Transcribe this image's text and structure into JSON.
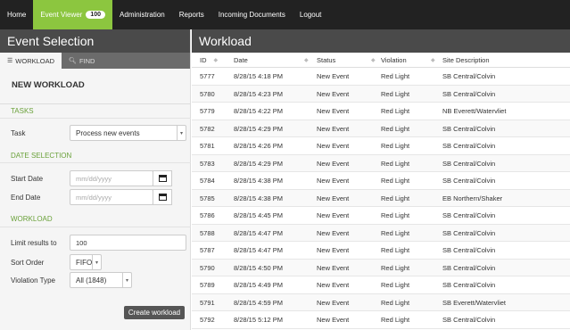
{
  "nav": {
    "home": "Home",
    "event_viewer": "Event Viewer",
    "event_viewer_badge": "100",
    "administration": "Administration",
    "reports": "Reports",
    "incoming_documents": "Incoming Documents",
    "logout": "Logout"
  },
  "left": {
    "title": "Event Selection",
    "tab_workload": "WORKLOAD",
    "tab_find": "FIND",
    "heading": "NEW WORKLOAD",
    "tasks_section": "TASKS",
    "task_label": "Task",
    "task_value": "Process new events",
    "date_section": "DATE SELECTION",
    "start_date_label": "Start Date",
    "start_date_placeholder": "mm/dd/yyyy",
    "end_date_label": "End Date",
    "end_date_placeholder": "mm/dd/yyyy",
    "workload_section": "WORKLOAD",
    "limit_label": "Limit results to",
    "limit_value": "100",
    "sort_label": "Sort Order",
    "sort_value": "FIFO",
    "violation_label": "Violation Type",
    "violation_value": "All (1848)",
    "create_button": "Create workload"
  },
  "right": {
    "title": "Workload",
    "columns": [
      "ID",
      "Date",
      "Status",
      "Violation",
      "Site Description"
    ],
    "rows": [
      [
        "5777",
        "8/28/15 4:18 PM",
        "New Event",
        "Red Light",
        "SB Central/Colvin"
      ],
      [
        "5780",
        "8/28/15 4:23 PM",
        "New Event",
        "Red Light",
        "SB Central/Colvin"
      ],
      [
        "5779",
        "8/28/15 4:22 PM",
        "New Event",
        "Red Light",
        "NB Everett/Watervliet"
      ],
      [
        "5782",
        "8/28/15 4:29 PM",
        "New Event",
        "Red Light",
        "SB Central/Colvin"
      ],
      [
        "5781",
        "8/28/15 4:26 PM",
        "New Event",
        "Red Light",
        "SB Central/Colvin"
      ],
      [
        "5783",
        "8/28/15 4:29 PM",
        "New Event",
        "Red Light",
        "SB Central/Colvin"
      ],
      [
        "5784",
        "8/28/15 4:38 PM",
        "New Event",
        "Red Light",
        "SB Central/Colvin"
      ],
      [
        "5785",
        "8/28/15 4:38 PM",
        "New Event",
        "Red Light",
        "EB Northern/Shaker"
      ],
      [
        "5786",
        "8/28/15 4:45 PM",
        "New Event",
        "Red Light",
        "SB Central/Colvin"
      ],
      [
        "5788",
        "8/28/15 4:47 PM",
        "New Event",
        "Red Light",
        "SB Central/Colvin"
      ],
      [
        "5787",
        "8/28/15 4:47 PM",
        "New Event",
        "Red Light",
        "SB Central/Colvin"
      ],
      [
        "5790",
        "8/28/15 4:50 PM",
        "New Event",
        "Red Light",
        "SB Central/Colvin"
      ],
      [
        "5789",
        "8/28/15 4:49 PM",
        "New Event",
        "Red Light",
        "SB Central/Colvin"
      ],
      [
        "5791",
        "8/28/15 4:59 PM",
        "New Event",
        "Red Light",
        "SB Everett/Watervliet"
      ],
      [
        "5792",
        "8/28/15 5:12 PM",
        "New Event",
        "Red Light",
        "SB Central/Colvin"
      ]
    ]
  },
  "colors": {
    "accent": "#8cc63f",
    "header_bg": "#4a4a4a",
    "nav_bg": "#222222",
    "section_green": "#6aa13a"
  }
}
